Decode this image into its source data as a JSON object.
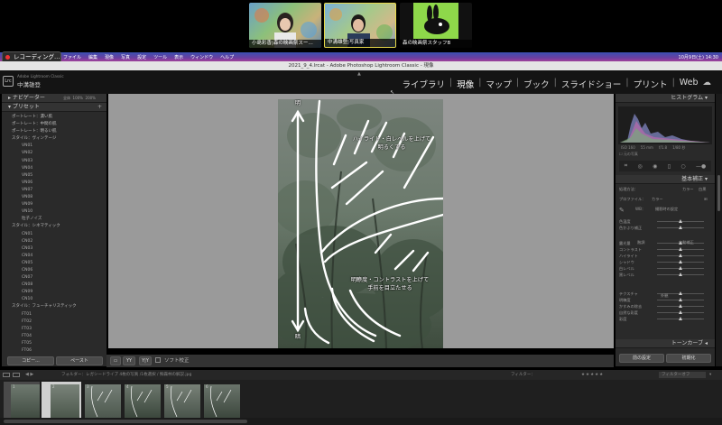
{
  "meeting": {
    "participants": [
      {
        "name": "小島彩香|森の映画祭スー…"
      },
      {
        "name": "中溝雄登|写真家"
      },
      {
        "name": "森の映画祭スタッフB"
      }
    ],
    "recording_label": "レコーディング…"
  },
  "menubar": {
    "items": [
      "ファイル",
      "編集",
      "現像",
      "写真",
      "設定",
      "ツール",
      "表示",
      "ウィンドウ",
      "ヘルプ"
    ],
    "clock": "10月9日(土) 14:30"
  },
  "window": {
    "title": "2021_9_4.lrcat - Adobe Photoshop Lightroom Classic - 現像"
  },
  "identity": {
    "small": "Adobe Lightroom Classic",
    "name": "中溝雄登"
  },
  "modules": {
    "items": [
      "ライブラリ",
      "現像",
      "マップ",
      "ブック",
      "スライドショー",
      "プリント",
      "Web"
    ],
    "active": 1
  },
  "navigator": {
    "title": "ナビゲーター",
    "zoom": [
      "全体",
      "100%",
      "200%"
    ]
  },
  "presets": {
    "title": "プリセット",
    "categories": [
      {
        "name": "ポートレート：濃い肌",
        "items": []
      },
      {
        "name": "ポートレート：中間の肌",
        "items": []
      },
      {
        "name": "ポートレート：明るい肌",
        "items": []
      },
      {
        "name": "スタイル：ヴィンテージ",
        "items": [
          "VN01",
          "VN02",
          "VN03",
          "VN04",
          "VN05",
          "VN06",
          "VN07",
          "VN08",
          "VN09",
          "VN10",
          "粒子ノイズ"
        ]
      },
      {
        "name": "スタイル：シネマティック",
        "items": [
          "CN01",
          "CN02",
          "CN03",
          "CN04",
          "CN05",
          "CN06",
          "CN07",
          "CN08",
          "CN09",
          "CN10"
        ]
      },
      {
        "name": "スタイル：フューチャリスティック",
        "items": [
          "FT01",
          "FT02",
          "FT03",
          "FT04",
          "FT05",
          "FT06"
        ]
      }
    ],
    "copy": "コピー...",
    "paste": "ペースト"
  },
  "histogram": {
    "title": "ヒストグラム",
    "readout": [
      "ISO 160",
      "55 mm",
      "f/1.8",
      "1/80 秒"
    ],
    "original_label": "元の写真"
  },
  "basic": {
    "title": "基本補正",
    "treatment": "処理方法：",
    "color": "カラー",
    "bw": "白黒",
    "profile_label": "プロファイル：",
    "profile_value": "カラー",
    "wb_label": "WB：",
    "wb_value": "撮影時の設定",
    "tone_label": "階調",
    "tone_auto": "自動補正",
    "presence_label": "外観",
    "sliders": [
      {
        "label": "色温度",
        "value": 0.5
      },
      {
        "label": "色かぶり補正",
        "value": 0.5
      },
      {
        "label": "露光量",
        "value": 0.5
      },
      {
        "label": "コントラスト",
        "value": 0.5
      },
      {
        "label": "ハイライト",
        "value": 0.5
      },
      {
        "label": "シャドウ",
        "value": 0.5
      },
      {
        "label": "白レベル",
        "value": 0.5
      },
      {
        "label": "黒レベル",
        "value": 0.5
      },
      {
        "label": "テクスチャ",
        "value": 0.5
      },
      {
        "label": "明瞭度",
        "value": 0.5
      },
      {
        "label": "かすみの除去",
        "value": 0.5
      },
      {
        "label": "自然な彩度",
        "value": 0.5
      },
      {
        "label": "彩度",
        "value": 0.5
      }
    ],
    "tone_curve": "トーンカーブ",
    "prev": "前の設定",
    "reset": "初期化"
  },
  "annotations": {
    "top_marker": "明",
    "bottom_marker": "暗",
    "note1_line1": "ハイライト・白レベルを上げて",
    "note1_line2": "明るくする",
    "note2_line1": "明瞭度・コントラストを上げて",
    "note2_line2": "手前を目立たせる"
  },
  "toolbar": {
    "softproof": "ソフト校正"
  },
  "filmstrip": {
    "path": "フォルダー：レガシードライブ  4枚の写真 /1枚選択 / 鮮霧林の解説.jpg",
    "filter_label": "フィルター：",
    "filter_value": "フィルターオフ",
    "numbers": [
      "1",
      "2",
      "3",
      "4",
      "5",
      "6"
    ]
  }
}
